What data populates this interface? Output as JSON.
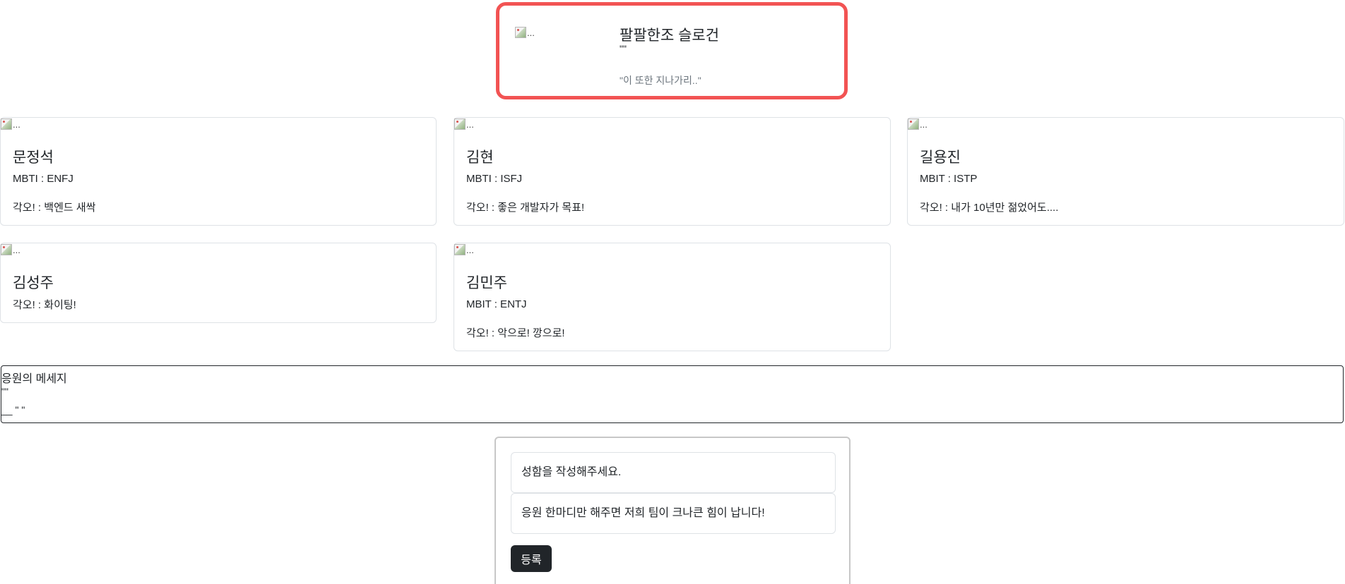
{
  "slogan": {
    "image_alt": "...",
    "title": "팔팔한조 슬로건",
    "quote_marks": "\"\"",
    "text": "\"이 또한 지나가리..\""
  },
  "members": [
    {
      "image_alt": "...",
      "name": "문정석",
      "mbti": "MBTI : ENFJ",
      "resolve": "각오! : 백엔드 새싹"
    },
    {
      "image_alt": "...",
      "name": "김현",
      "mbti": "MBTI : ISFJ",
      "resolve": "각오! : 좋은 개발자가 목표!"
    },
    {
      "image_alt": "...",
      "name": "길용진",
      "mbti": "MBIT : ISTP",
      "resolve": "각오! : 내가 10년만 젊었어도...."
    },
    {
      "image_alt": "...",
      "name": "김성주",
      "resolve": "각오! : 화이팅!"
    },
    {
      "image_alt": "...",
      "name": "김민주",
      "mbti": "MBIT : ENTJ",
      "resolve": "각오! : 악으로! 깡으로!"
    }
  ],
  "cheer": {
    "title": "응원의 메세지",
    "quote_marks": "\"\"",
    "signature": "__ \" \""
  },
  "form": {
    "name_placeholder": "성함을 작성해주세요.",
    "message_placeholder": "응원 한마디만 해주면 저희 팀이 크나큰 힘이 납니다!",
    "submit_label": "등록"
  }
}
